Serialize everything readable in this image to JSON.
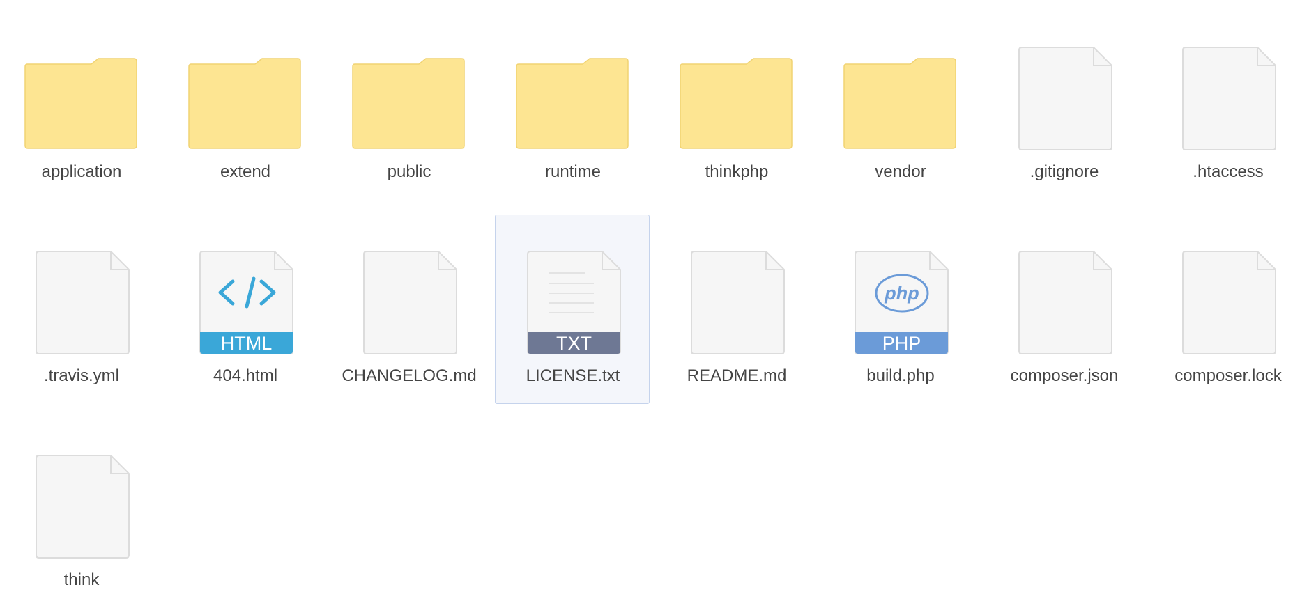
{
  "items": [
    {
      "name": "application",
      "kind": "folder",
      "icon": "folder-icon"
    },
    {
      "name": "extend",
      "kind": "folder",
      "icon": "folder-icon"
    },
    {
      "name": "public",
      "kind": "folder",
      "icon": "folder-icon"
    },
    {
      "name": "runtime",
      "kind": "folder",
      "icon": "folder-icon"
    },
    {
      "name": "thinkphp",
      "kind": "folder",
      "icon": "folder-icon"
    },
    {
      "name": "vendor",
      "kind": "folder",
      "icon": "folder-icon"
    },
    {
      "name": ".gitignore",
      "kind": "file",
      "icon": "file-icon"
    },
    {
      "name": ".htaccess",
      "kind": "file",
      "icon": "file-icon"
    },
    {
      "name": ".travis.yml",
      "kind": "file",
      "icon": "file-icon"
    },
    {
      "name": "404.html",
      "kind": "html",
      "icon": "html-file-icon",
      "badge": "HTML",
      "badge_color": "#3aa7d8"
    },
    {
      "name": "CHANGELOG.md",
      "kind": "file",
      "icon": "file-icon"
    },
    {
      "name": "LICENSE.txt",
      "kind": "txt",
      "icon": "txt-file-icon",
      "badge": "TXT",
      "badge_color": "#6e7894",
      "selected": true
    },
    {
      "name": "README.md",
      "kind": "file",
      "icon": "file-icon"
    },
    {
      "name": "build.php",
      "kind": "php",
      "icon": "php-file-icon",
      "badge": "PHP",
      "badge_color": "#6b9bd8",
      "logo_text": "php"
    },
    {
      "name": "composer.json",
      "kind": "file",
      "icon": "file-icon"
    },
    {
      "name": "composer.lock",
      "kind": "file",
      "icon": "file-icon"
    },
    {
      "name": "think",
      "kind": "file",
      "icon": "file-icon"
    }
  ],
  "colors": {
    "folder_fill": "#fde592",
    "folder_stroke": "#f1d373",
    "file_fill": "#f6f6f6",
    "file_stroke": "#dcdcdc",
    "selection_bg": "#f4f6fb",
    "selection_border": "#c5d3ec",
    "label_color": "#444444"
  }
}
